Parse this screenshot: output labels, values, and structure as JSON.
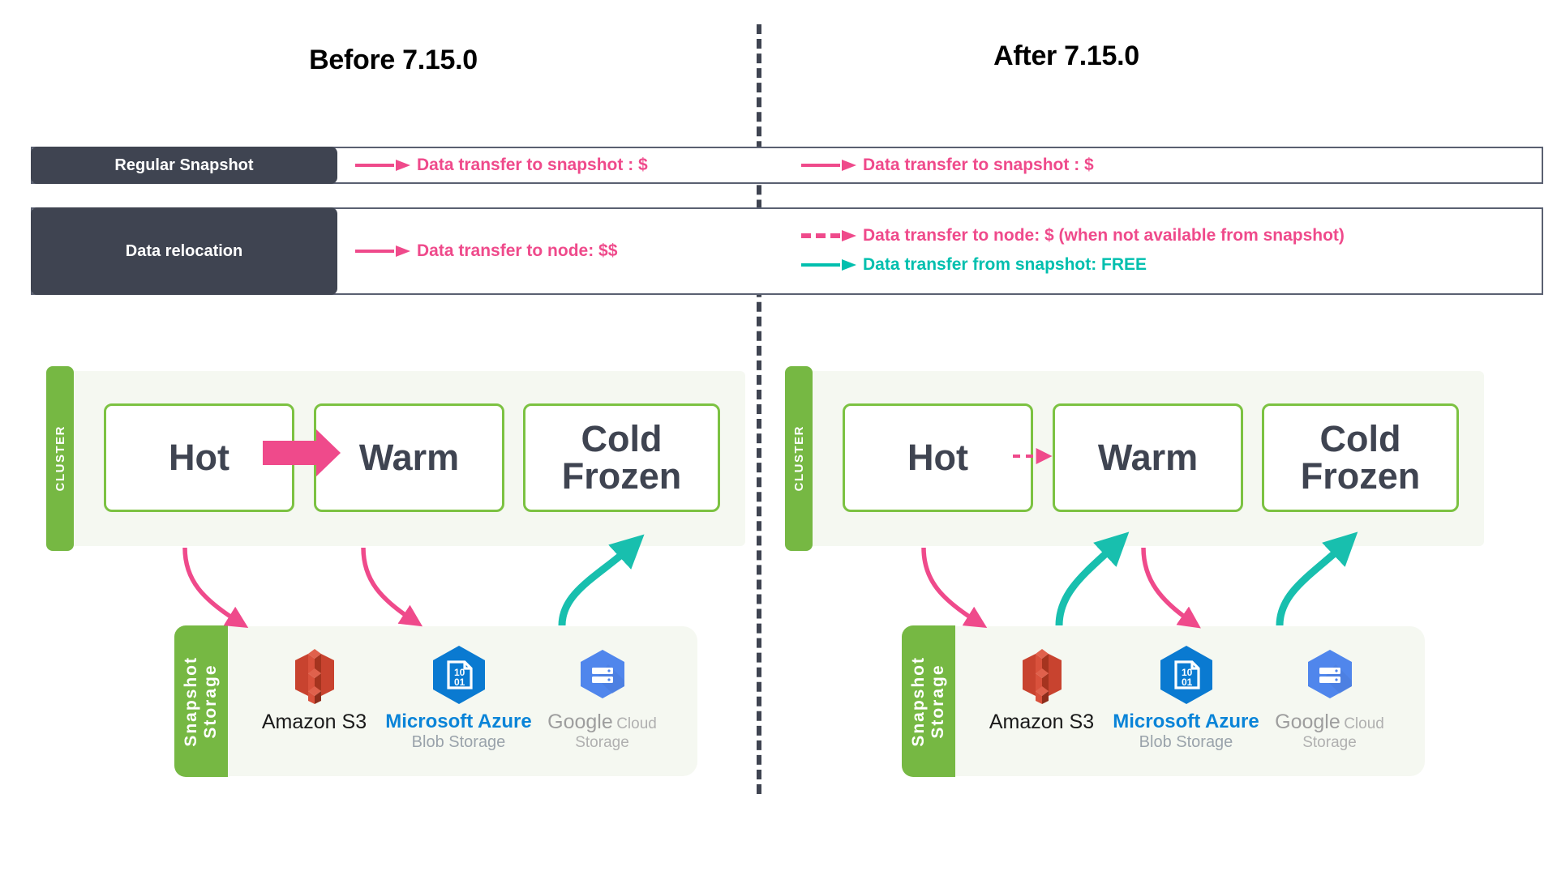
{
  "titles": {
    "before": "Before 7.15.0",
    "after": "After 7.15.0"
  },
  "legend": {
    "rows": [
      {
        "label": "Regular Snapshot",
        "before": [
          {
            "style": "solid",
            "color": "#ef4a8b",
            "text": "Data transfer to snapshot : $"
          }
        ],
        "after": [
          {
            "style": "solid",
            "color": "#ef4a8b",
            "text": "Data transfer to snapshot : $"
          }
        ]
      },
      {
        "label": "Data relocation",
        "before": [
          {
            "style": "solid",
            "color": "#ef4a8b",
            "text": "Data transfer to node: $$"
          }
        ],
        "after": [
          {
            "style": "dashed",
            "color": "#ef4a8b",
            "text": "Data transfer to node: $  (when not available from snapshot)"
          },
          {
            "style": "solid",
            "color": "#00bfae",
            "text": "Data transfer from snapshot: FREE"
          }
        ]
      }
    ]
  },
  "panels": {
    "cluster_label": "CLUSTER",
    "storage_label_line1": "Snapshot",
    "storage_label_line2": "Storage"
  },
  "tiers": {
    "hot": "Hot",
    "warm": "Warm",
    "cold_line1": "Cold",
    "cold_line2": "Frozen"
  },
  "storage_providers": [
    {
      "id": "amazon-s3",
      "caption_main": "Amazon S3",
      "caption_sub": ""
    },
    {
      "id": "microsoft-azure-blob-storage",
      "caption_main": "Microsoft Azure",
      "caption_sub": "Blob Storage"
    },
    {
      "id": "google-cloud-storage",
      "caption_main": "Google",
      "caption_sub": "Cloud Storage"
    }
  ],
  "colors": {
    "pink": "#ef4a8b",
    "teal": "#00bfae",
    "green": "#76b843",
    "green_border": "#7cc242",
    "dark_slate": "#3f4451",
    "panel_bg": "#f5f8f1",
    "table_border": "#5a6071"
  }
}
